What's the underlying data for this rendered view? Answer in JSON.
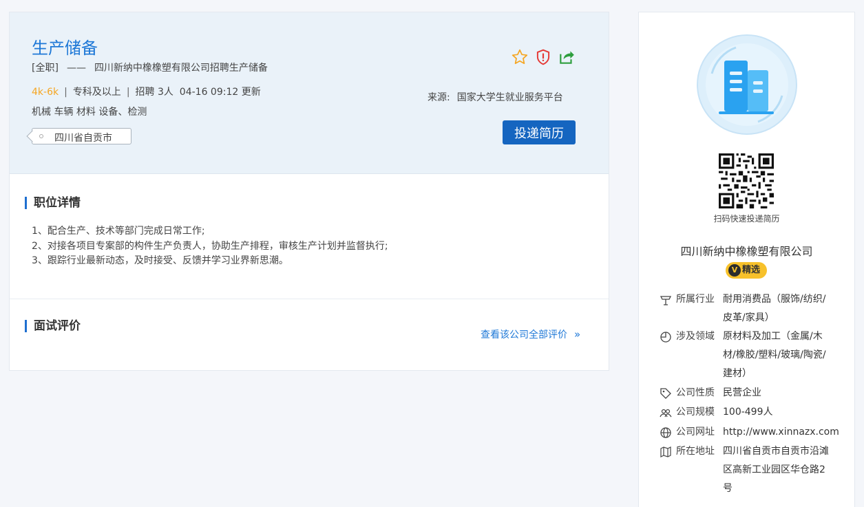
{
  "job": {
    "title": "生产储备",
    "type": "[全职]",
    "dash": "——",
    "subtitle": "四川新纳中橡橡塑有限公司招聘生产储备",
    "salary": "4k-6k",
    "sep": "|",
    "education": "专科及以上",
    "hiring": "招聘 3人",
    "updated": "04-16 09:12 更新",
    "tags": "机械 车辆 材料 设备、检测",
    "location": "四川省自贡市",
    "source_label": "来源:",
    "source_value": "国家大学生就业服务平台",
    "apply_label": "投递简历",
    "icons": {
      "favorite": "star-icon",
      "report": "shield-alert-icon",
      "share": "share-icon"
    },
    "colors": {
      "accent": "#1e78d7",
      "salary": "#f5a623",
      "button": "#1565c0"
    }
  },
  "detail": {
    "title": "职位详情",
    "lines": [
      "1、配合生产、技术等部门完成日常工作;",
      "2、对接各项目专案部的构件生产负责人，协助生产排程，审核生产计划并监督执行;",
      "3、跟踪行业最新动态，及时接受、反馈并学习业界新思潮。"
    ]
  },
  "review": {
    "title": "面试评价",
    "link": "查看该公司全部评价",
    "chevron": "»"
  },
  "company": {
    "qr_caption": "扫码快速投递简历",
    "name": "四川新纳中橡橡塑有限公司",
    "badge_v": "V",
    "badge": "精选",
    "info": [
      {
        "icon": "industry-icon",
        "key": "所属行业",
        "value": "耐用消费品（服饰/纺织/皮革/家具）"
      },
      {
        "icon": "domain-icon",
        "key": "涉及领域",
        "value": "原材料及加工（金属/木材/橡胶/塑料/玻璃/陶瓷/建材）"
      },
      {
        "icon": "tag-icon",
        "key": "公司性质",
        "value": "民营企业"
      },
      {
        "icon": "people-icon",
        "key": "公司规模",
        "value": "100-499人"
      },
      {
        "icon": "globe-icon",
        "key": "公司网址",
        "value": "http://www.xinnazx.com"
      },
      {
        "icon": "map-icon",
        "key": "所在地址",
        "value": "四川省自贡市自贡市沿滩区高新工业园区华仓路2号"
      }
    ]
  }
}
